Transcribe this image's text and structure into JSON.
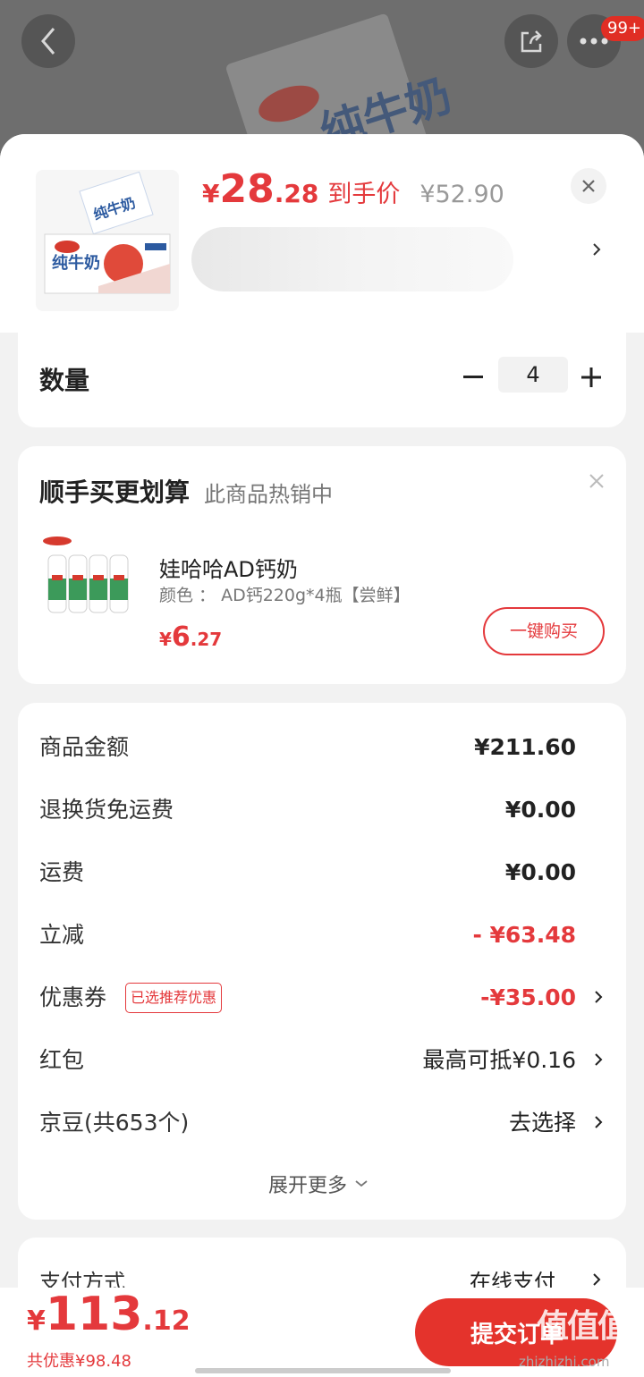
{
  "background": {
    "product_text": "纯牛奶",
    "cart_badge": "99+"
  },
  "header": {
    "price_yen": "¥",
    "price_int": "28",
    "price_dec": ".28",
    "price_tag": "到手价",
    "price_orig": "¥52.90"
  },
  "quantity": {
    "label": "数量",
    "value": "4"
  },
  "upsell": {
    "title": "顺手买更划算",
    "subtitle": "此商品热销中",
    "name": "娃哈哈AD钙奶",
    "spec": "颜色 ： AD钙220g*4瓶【尝鲜】",
    "price_yen": "¥",
    "price_int": "6",
    "price_dec": ".27",
    "button": "一键购买"
  },
  "summary": {
    "rows": [
      {
        "label": "商品金额",
        "value": "¥211.60"
      },
      {
        "label": "退换货免运费",
        "value": "¥0.00"
      },
      {
        "label": "运费",
        "value": "¥0.00"
      },
      {
        "label": "立减",
        "value": "- ¥63.48"
      },
      {
        "label": "优惠券",
        "tag": "已选推荐优惠",
        "value": "-¥35.00"
      },
      {
        "label": "红包",
        "value": "最高可抵¥0.16"
      },
      {
        "label": "京豆(共653个)",
        "value": "去选择"
      }
    ],
    "expand": "展开更多"
  },
  "payment": {
    "label": "支付方式",
    "value": "在线支付"
  },
  "footer": {
    "total_yen": "¥",
    "total_int": "113",
    "total_dec": ".12",
    "saving": "共优惠¥98.48",
    "submit": "提交订单",
    "watermark": "zhizhizhi.com",
    "watermark_logo": "值值值"
  },
  "colors": {
    "accent": "#e4393c"
  }
}
